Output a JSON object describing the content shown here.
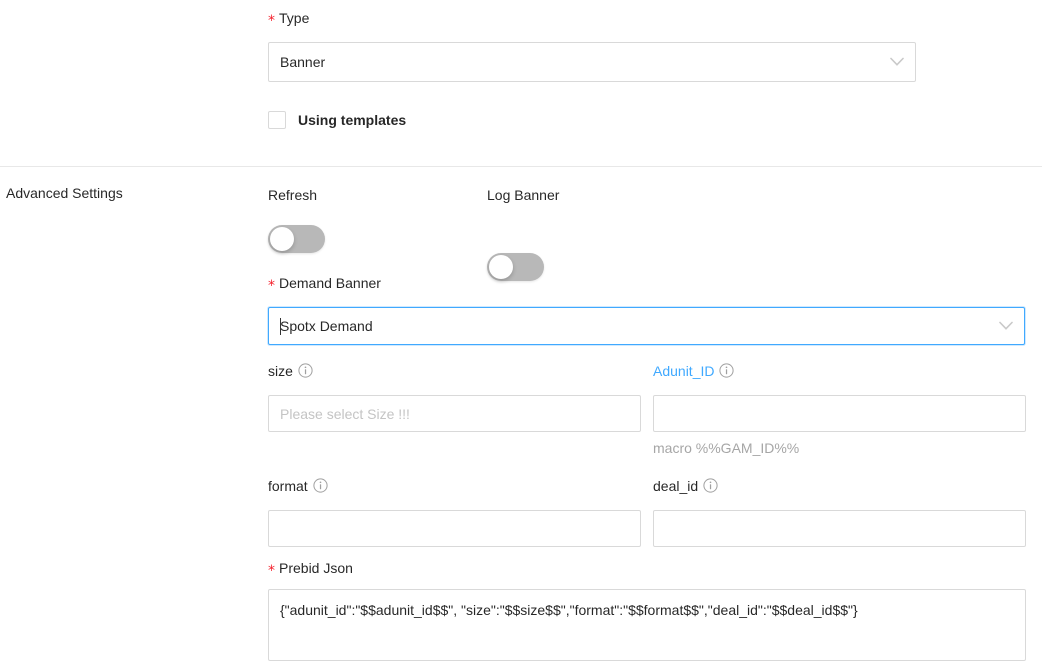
{
  "form": {
    "type_field": {
      "label": "Type",
      "required": true,
      "value": "Banner",
      "chevron_icon": "chevron-down-icon"
    },
    "using_templates": {
      "label": "Using templates",
      "checked": false
    },
    "section": {
      "title": "Advanced Settings"
    },
    "refresh_toggle": {
      "label": "Refresh",
      "state": "off"
    },
    "log_banner_toggle": {
      "label": "Log Banner",
      "state": "off"
    },
    "demand_banner": {
      "label": "Demand Banner",
      "required": true,
      "value": "Spotx Demand",
      "focused": true,
      "chevron_icon": "chevron-down-icon"
    },
    "size_field": {
      "label": "size",
      "info_icon": "info-circle-icon",
      "value": "",
      "placeholder": "Please select Size !!!"
    },
    "adunit_id_field": {
      "label": "Adunit_ID",
      "info_icon": "info-circle-icon",
      "value": "",
      "placeholder": "",
      "helper": "macro %%GAM_ID%%",
      "label_color": "#40a9ff"
    },
    "format_field": {
      "label": "format",
      "info_icon": "info-circle-icon",
      "value": "",
      "placeholder": ""
    },
    "deal_id_field": {
      "label": "deal_id",
      "info_icon": "info-circle-icon",
      "value": "",
      "placeholder": ""
    },
    "prebid_json": {
      "label": "Prebid Json",
      "required": true,
      "value": "{\"adunit_id\":\"$$adunit_id$$\", \"size\":\"$$size$$\",\"format\":\"$$format$$\",\"deal_id\":\"$$deal_id$$\"}"
    }
  },
  "colors": {
    "required_star": "#f5222d",
    "link_blue": "#40a9ff",
    "border": "#d9d9d9",
    "placeholder": "#c4c4c4",
    "switch_off": "#b8b8b8",
    "divider": "#e8e8e8"
  }
}
